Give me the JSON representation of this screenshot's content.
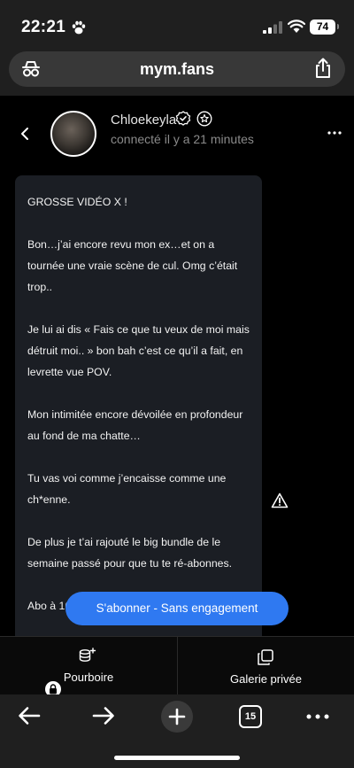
{
  "status_bar": {
    "time": "22:21",
    "battery": "74"
  },
  "browser": {
    "url": "mym.fans",
    "tab_count": "15"
  },
  "profile": {
    "name": "Chloekeyla",
    "status": "connecté il y a 21 minutes"
  },
  "message": {
    "paragraphs": [
      "GROSSE VIDÉO X !",
      "Bon…j’ai encore revu mon ex…et on a tournée une vraie scène de cul. Omg c’était trop..",
      "Je lui ai dis « Fais ce que tu veux de moi mais détruit moi.. » bon bah c’est ce qu’il a fait, en levrette vue POV.",
      "Mon intimitée encore dévoilée en profondeur au fond de ma chatte…",
      "Tu vas voi comme j’encaisse comme une ch*enne.",
      "De plus je t’ai rajouté le big bundle de le semaine passé pour que tu te ré-abonnes.",
      "Abo à 16€ débloques la vidéo."
    ]
  },
  "subscribe_button": "S'abonner - Sans engagement",
  "actions": {
    "tip_label": "Pourboire",
    "gallery_label": "Galerie privée"
  },
  "colors": {
    "accent": "#2f79f1",
    "bubble": "#1b1e24",
    "chrome": "#1f1f1f"
  }
}
